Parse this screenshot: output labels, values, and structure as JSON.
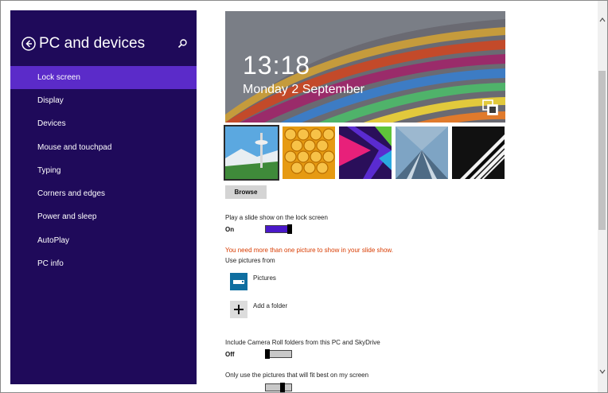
{
  "sidebar": {
    "title": "PC and devices",
    "items": [
      {
        "label": "Lock screen",
        "active": true
      },
      {
        "label": "Display"
      },
      {
        "label": "Devices"
      },
      {
        "label": "Mouse and touchpad"
      },
      {
        "label": "Typing"
      },
      {
        "label": "Corners and edges"
      },
      {
        "label": "Power and sleep"
      },
      {
        "label": "AutoPlay"
      },
      {
        "label": "PC info"
      }
    ],
    "back_icon": "back-arrow-icon",
    "search_icon": "search-icon"
  },
  "preview": {
    "time": "13:18",
    "date": "Monday 2 September",
    "icon": "camera-switch-icon"
  },
  "thumbnails": [
    {
      "name": "space-needle",
      "selected": true
    },
    {
      "name": "honeycomb"
    },
    {
      "name": "ribbons"
    },
    {
      "name": "rails"
    },
    {
      "name": "piano"
    }
  ],
  "browse_label": "Browse",
  "slideshow": {
    "label": "Play a slide show on the lock screen",
    "state": "On",
    "on": true
  },
  "warning": "You need more than one picture to show in your slide show.",
  "use_pictures_label": "Use pictures from",
  "sources": [
    {
      "label": "Pictures",
      "icon": "pictures-library-icon"
    },
    {
      "label": "Add a folder",
      "icon": "plus-icon"
    }
  ],
  "camera_roll": {
    "label": "Include Camera Roll folders from this PC and SkyDrive",
    "state": "Off",
    "on": false
  },
  "fit_best": {
    "label": "Only use the pictures that will fit best on my screen"
  },
  "colors": {
    "sidebar_bg": "#1f0a5a",
    "sidebar_active": "#5b2bc9",
    "toggle_on": "#4a18c9",
    "warning": "#d83b01"
  }
}
